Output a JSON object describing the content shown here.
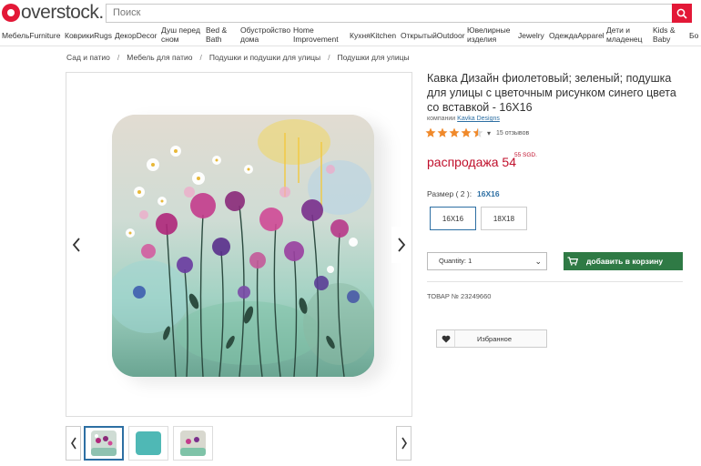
{
  "header": {
    "logo_text": "overstock.",
    "search_placeholder": "Поиск"
  },
  "nav": {
    "items": [
      "МебельFurniture",
      "КоврикиRugs",
      "ДекорDecor",
      "Душ перед сном",
      "Bed & Bath",
      "Обустройство дома",
      "Home Improvement",
      "КухняKitchen",
      "ОткрытыйOutdoor",
      "Ювелирные изделия",
      "Jewelry",
      "ОдеждаApparel",
      "Дети и младенец",
      "Kids & Baby",
      "Бо"
    ]
  },
  "breadcrumbs": [
    "Сад и патио",
    "Мебель для патио",
    "Подушки и подушки для улицы",
    "Подушки для улицы"
  ],
  "product": {
    "title": "Кавка Дизайн фиолетовый; зеленый; подушка для улицы с цветочным рисунком синего цвета со вставкой - 16X16",
    "by_label": "компании",
    "brand": "Kavka Designs",
    "rating": 4.5,
    "reviews": "15 отзывов",
    "price_label": "распродажа 54",
    "price_sup": "55 SGD.",
    "size_label": "Размер ( 2 ):",
    "size_value": "16X16",
    "sizes": [
      "16X16",
      "18X18"
    ],
    "quantity": "Quantity: 1",
    "add_to_cart": "добавить в корзину",
    "sku": "ТОВАР № 23249660",
    "favorite": "Избранное"
  },
  "colors": {
    "brand_red": "#e31837",
    "cart_green": "#2f7a45",
    "link_blue": "#2d6fa3",
    "star_orange": "#f0892a",
    "price_red": "#c0102c"
  }
}
